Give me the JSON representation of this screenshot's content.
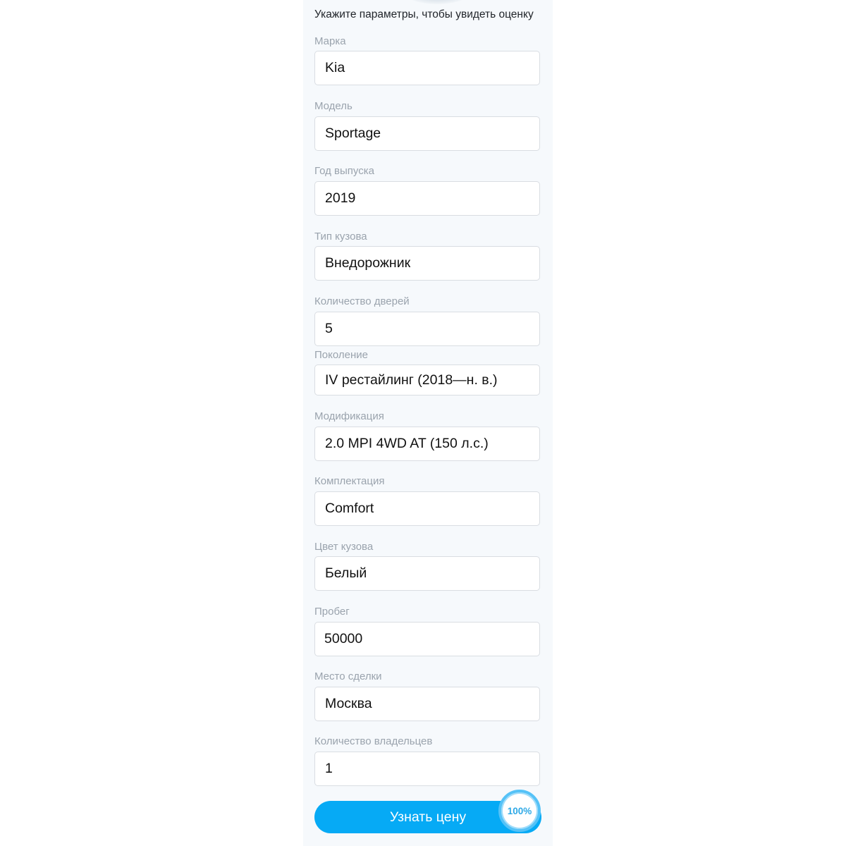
{
  "form": {
    "hint": "Укажите параметры, чтобы увидеть оценку",
    "fields": [
      {
        "label": "Марка",
        "value": "Kia"
      },
      {
        "label": "Модель",
        "value": "Sportage"
      },
      {
        "label": "Год выпуска",
        "value": "2019"
      },
      {
        "label": "Тип кузова",
        "value": "Внедорожник"
      },
      {
        "label": "Количество дверей",
        "value": "5"
      },
      {
        "label": "Поколение",
        "value": "IV рестайлинг (2018—н. в.)"
      },
      {
        "label": "Модификация",
        "value": "2.0 MPI 4WD AT (150 л.с.)"
      },
      {
        "label": "Комплектация",
        "value": "Comfort"
      },
      {
        "label": "Цвет кузова",
        "value": "Белый"
      },
      {
        "label": "Пробег",
        "value": "50000"
      },
      {
        "label": "Место сделки",
        "value": "Москва"
      },
      {
        "label": "Количество владельцев",
        "value": "1"
      }
    ],
    "submit_label": "Узнать цену",
    "progress_text": "100%",
    "progress_value": 100,
    "accent_color": "#06aaf5"
  }
}
